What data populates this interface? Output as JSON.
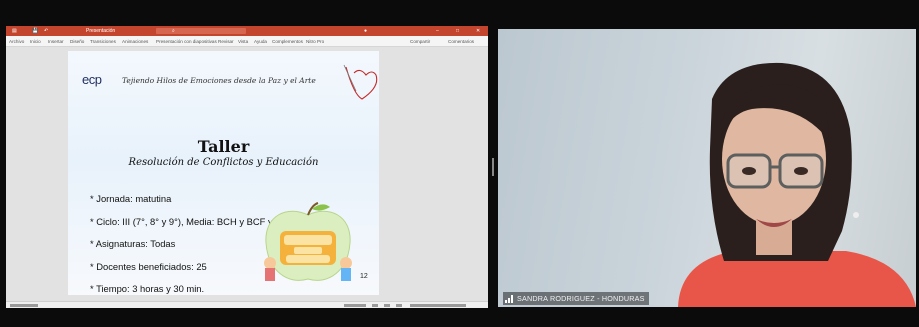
{
  "presentation": {
    "window_title": "Presentación",
    "ribbon_tabs": [
      "Archivo",
      "Inicio",
      "Insertar",
      "Diseño",
      "Transiciones",
      "Animaciones",
      "Presentación con diapositivas",
      "Revisar",
      "Vista",
      "Ayuda",
      "Complementos",
      "Nitro Pro"
    ],
    "share_label": "Compartir",
    "comments_label": "Comentarios",
    "slide": {
      "logo": "ecp",
      "motto": "Tejiendo Hilos de Emociones desde la Paz y el Arte",
      "title": "Taller",
      "subtitle": "Resolución de Conflictos y Educación",
      "bullets": [
        "Jornada: matutina",
        "Ciclo: III (7°, 8° y 9°), Media: BCH y BCF y Directivos",
        "Asignaturas: Todas",
        "Docentes beneficiados: 25",
        "Tiempo: 3 horas y 30 min."
      ],
      "page_number": "12"
    }
  },
  "video": {
    "participant_name": "SANDRA RODRIGUEZ - HONDURAS"
  },
  "colors": {
    "titlebar": "#c4452e",
    "title_text": "#111111",
    "shirt": "#e8564a"
  }
}
